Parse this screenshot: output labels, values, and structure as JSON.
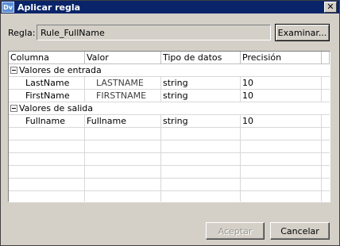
{
  "window": {
    "title": "Aplicar regla",
    "icon_text": "Dv",
    "close_glyph": "✕"
  },
  "rule": {
    "label": "Regla:",
    "value": "Rule_FullName",
    "browse_label": "Examinar..."
  },
  "table": {
    "columns": [
      "Columna",
      "Valor",
      "Tipo de datos",
      "Precisión"
    ],
    "groups": [
      {
        "label": "Valores de entrada",
        "rows": [
          {
            "column": "LastName",
            "value": "LASTNAME",
            "type": "string",
            "precision": "10"
          },
          {
            "column": "FirstName",
            "value": "FIRSTNAME",
            "type": "string",
            "precision": "10"
          }
        ]
      },
      {
        "label": "Valores de salida",
        "rows": [
          {
            "column": "Fullname",
            "value": "Fullname",
            "type": "string",
            "precision": "10"
          }
        ]
      }
    ]
  },
  "buttons": {
    "accept": "Aceptar",
    "cancel": "Cancelar"
  }
}
